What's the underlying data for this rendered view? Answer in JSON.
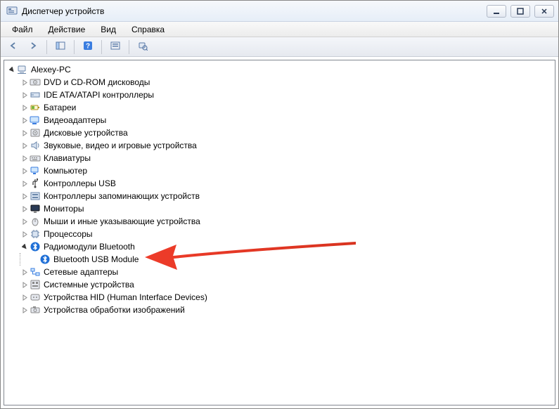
{
  "window": {
    "title": "Диспетчер устройств"
  },
  "menu": {
    "file": "Файл",
    "action": "Действие",
    "view": "Вид",
    "help": "Справка"
  },
  "tree": {
    "root": "Alexey-PC",
    "items": [
      {
        "label": "DVD и CD-ROM дисководы",
        "icon": "drive-icon"
      },
      {
        "label": "IDE ATA/ATAPI контроллеры",
        "icon": "controller-icon"
      },
      {
        "label": "Батареи",
        "icon": "battery-icon"
      },
      {
        "label": "Видеоадаптеры",
        "icon": "display-adapter-icon"
      },
      {
        "label": "Дисковые устройства",
        "icon": "disk-icon"
      },
      {
        "label": "Звуковые, видео и игровые устройства",
        "icon": "sound-icon"
      },
      {
        "label": "Клавиатуры",
        "icon": "keyboard-icon"
      },
      {
        "label": "Компьютер",
        "icon": "computer-icon"
      },
      {
        "label": "Контроллеры USB",
        "icon": "usb-icon"
      },
      {
        "label": "Контроллеры запоминающих устройств",
        "icon": "storage-controller-icon"
      },
      {
        "label": "Мониторы",
        "icon": "monitor-icon"
      },
      {
        "label": "Мыши и иные указывающие устройства",
        "icon": "mouse-icon"
      },
      {
        "label": "Процессоры",
        "icon": "processor-icon"
      },
      {
        "label": "Радиомодули Bluetooth",
        "icon": "bluetooth-icon",
        "expanded": true,
        "children": [
          {
            "label": "Bluetooth USB Module",
            "icon": "bluetooth-icon"
          }
        ]
      },
      {
        "label": "Сетевые адаптеры",
        "icon": "network-icon"
      },
      {
        "label": "Системные устройства",
        "icon": "system-icon"
      },
      {
        "label": "Устройства HID (Human Interface Devices)",
        "icon": "hid-icon"
      },
      {
        "label": "Устройства обработки изображений",
        "icon": "imaging-icon"
      }
    ]
  },
  "arrow": {
    "color": "#ee3c2a"
  }
}
